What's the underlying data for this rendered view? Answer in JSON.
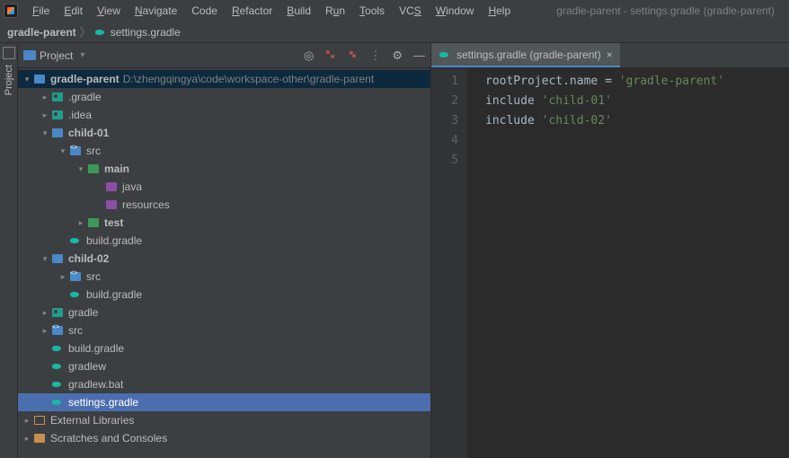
{
  "window_title": "gradle-parent - settings.gradle (gradle-parent)",
  "menu": {
    "file": "File",
    "edit": "Edit",
    "view": "View",
    "navigate": "Navigate",
    "code": "Code",
    "refactor": "Refactor",
    "build": "Build",
    "run": "Run",
    "tools": "Tools",
    "vcs": "VCS",
    "window": "Window",
    "help": "Help"
  },
  "breadcrumb": {
    "root": "gradle-parent",
    "file": "settings.gradle"
  },
  "project_panel": {
    "title": "Project"
  },
  "side_label": "Project",
  "tree": {
    "root": "gradle-parent",
    "root_path": "D:\\zhengqingya\\code\\workspace-other\\gradle-parent",
    "dot_gradle": ".gradle",
    "dot_idea": ".idea",
    "child01": "child-01",
    "src": "src",
    "main": "main",
    "java": "java",
    "resources": "resources",
    "test": "test",
    "build_gradle": "build.gradle",
    "child02": "child-02",
    "gradle_dir": "gradle",
    "gradlew": "gradlew",
    "gradlew_bat": "gradlew.bat",
    "settings_gradle": "settings.gradle",
    "ext_libs": "External Libraries",
    "scratches": "Scratches and Consoles"
  },
  "editor_tab": {
    "label": "settings.gradle (gradle-parent)"
  },
  "code": {
    "l1_a": "rootProject.name ",
    "l1_op": "= ",
    "l1_str": "'gradle-parent'",
    "l2_a": "include ",
    "l2_str": "'child-01'",
    "l3_a": "include ",
    "l3_str": "'child-02'"
  },
  "gutter": {
    "n1": "1",
    "n2": "2",
    "n3": "3",
    "n4": "4",
    "n5": "5"
  }
}
